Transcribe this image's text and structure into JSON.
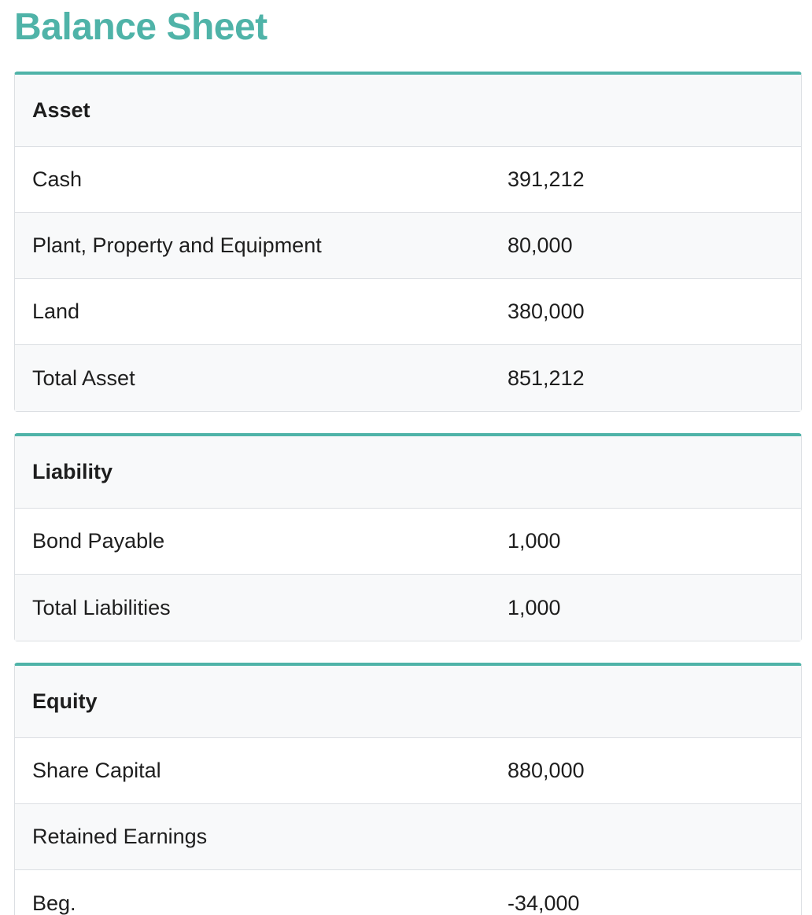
{
  "page": {
    "title": "Balance Sheet"
  },
  "colors": {
    "accent": "#4fb3a8",
    "header_bg": "#f8f9fa",
    "border": "#dcdfe3"
  },
  "sections": {
    "asset": {
      "heading": "Asset",
      "rows": [
        {
          "label": "Cash",
          "value": "391,212"
        },
        {
          "label": "Plant, Property and Equipment",
          "value": "80,000"
        },
        {
          "label": "Land",
          "value": "380,000"
        },
        {
          "label": "Total Asset",
          "value": "851,212"
        }
      ]
    },
    "liability": {
      "heading": "Liability",
      "rows": [
        {
          "label": "Bond Payable",
          "value": "1,000"
        },
        {
          "label": "Total Liabilities",
          "value": "1,000"
        }
      ]
    },
    "equity": {
      "heading": "Equity",
      "rows": [
        {
          "label": "Share Capital",
          "value": "880,000"
        },
        {
          "label": "Retained Earnings",
          "value": ""
        },
        {
          "label": "Beg.",
          "value": "-34,000"
        }
      ]
    }
  }
}
